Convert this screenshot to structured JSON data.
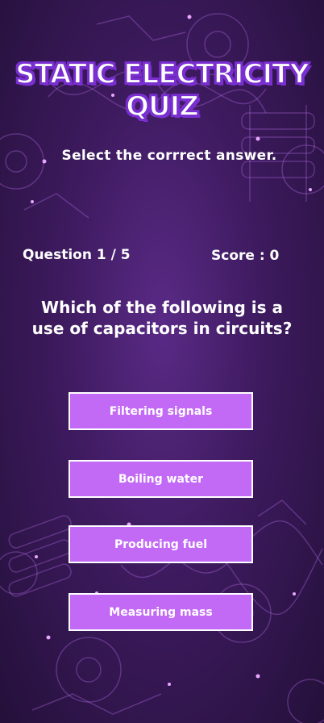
{
  "title": {
    "line1": "STATIC ELECTRICITY",
    "line2": "QUIZ"
  },
  "subtitle": "Select the corrrect answer.",
  "status": {
    "question": "Question 1 / 5",
    "score": "Score : 0"
  },
  "question": "Which of the following is a use of capacitors in circuits?",
  "options": [
    {
      "label": "Filtering signals"
    },
    {
      "label": "Boiling water"
    },
    {
      "label": "Producing fuel"
    },
    {
      "label": "Measuring mass"
    }
  ],
  "colors": {
    "accent": "#c26af6",
    "title_outline": "#7a2fd0",
    "bg_dark": "#24103a",
    "bg_mid": "#5a2a86"
  }
}
